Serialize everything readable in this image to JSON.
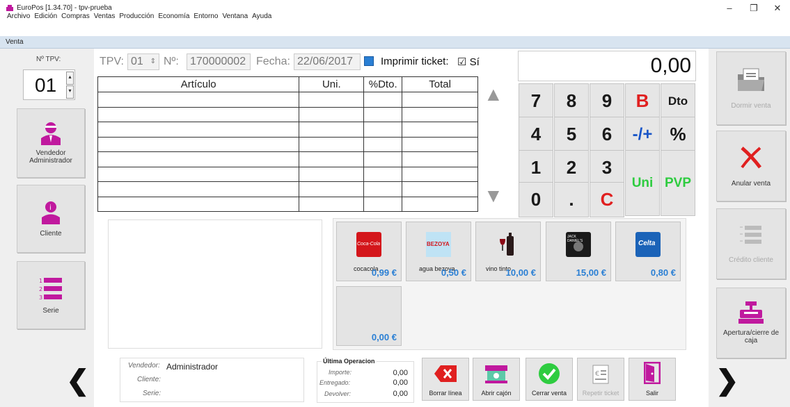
{
  "window": {
    "title": "EuroPos [1.34.70] - tpv-prueba",
    "minimize": "–",
    "maximize": "❐",
    "close": "✕"
  },
  "menu": [
    "Archivo",
    "Edición",
    "Compras",
    "Ventas",
    "Producción",
    "Economía",
    "Entorno",
    "Ventana",
    "Ayuda"
  ],
  "tab": "Venta",
  "tpv_panel": {
    "label": "Nº TPV:",
    "value": "01"
  },
  "header": {
    "tpv_label": "TPV:",
    "tpv_value": "01",
    "num_label": "Nº:",
    "num_value": "170000002",
    "fecha_label": "Fecha:",
    "fecha_value": "22/06/2017",
    "print_label": "Imprimir ticket:",
    "print_value": "☑ Sí"
  },
  "table": {
    "columns": [
      "Artículo",
      "Uni.",
      "%Dto.",
      "Total"
    ],
    "rows": 8
  },
  "display": "0,00",
  "keypad": {
    "rows": [
      [
        "7",
        "8",
        "9",
        "B",
        "Dto"
      ],
      [
        "4",
        "5",
        "6",
        "-/+",
        "%"
      ],
      [
        "1",
        "2",
        "3",
        "Uni",
        "PVP"
      ],
      [
        "0",
        ".",
        "C"
      ]
    ]
  },
  "left_buttons": {
    "vendedor": "Vendedor Administrador",
    "cliente": "Cliente",
    "serie": "Serie"
  },
  "right_buttons": {
    "dormir": "Dormir venta",
    "anular": "Anular venta",
    "credito": "Crédito cliente",
    "apertura": "Apertura/cierre de caja"
  },
  "products": [
    {
      "name": "cocacola",
      "price": "0,99 €"
    },
    {
      "name": "agua bezoya",
      "price": "0,50 €"
    },
    {
      "name": "vino tinto",
      "price": "10,00 €"
    },
    {
      "name": "",
      "price": "15,00 €"
    },
    {
      "name": "",
      "price": "0,80 €"
    },
    {
      "name": "",
      "price": "0,00 €"
    }
  ],
  "logos": {
    "coke": "Coca-Cola",
    "bezoya": "BEZOYA",
    "celta": "Celta",
    "jack": "JACK DANIEL'S"
  },
  "footer": {
    "vendedor_label": "Vendedor:",
    "vendedor_value": "Administrador",
    "cliente_label": "Cliente:",
    "serie_label": "Serie:",
    "ultima": "Última Operacion",
    "importe_label": "Importe:",
    "importe": "0,00",
    "entregado_label": "Entregado:",
    "entregado": "0,00",
    "devolver_label": "Devolver:",
    "devolver": "0,00"
  },
  "actions": {
    "borrar": "Borrar línea",
    "abrir": "Abrir cajón",
    "cerrar": "Cerrar venta",
    "repetir": "Repetir ticket",
    "salir": "Salir"
  },
  "nav": {
    "prev": "❮",
    "next": "❯",
    "up": "▲",
    "down": "▼"
  },
  "colors": {
    "magenta": "#c0199e",
    "red": "#e02020",
    "green": "#2ecc40",
    "blue": "#1a56c8",
    "price_blue": "#2a7fd4"
  }
}
